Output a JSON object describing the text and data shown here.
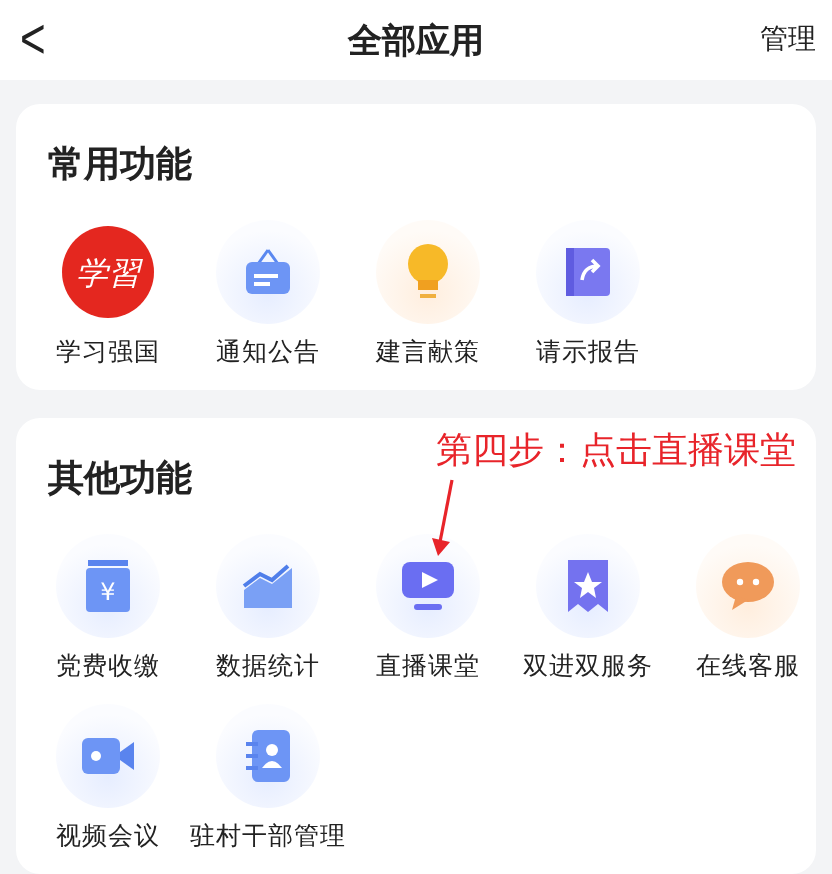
{
  "header": {
    "back": "<",
    "title": "全部应用",
    "action": "管理"
  },
  "sections": [
    {
      "title": "常用功能",
      "apps": [
        {
          "label": "学习强国",
          "kind": "logo",
          "logo_text": "学習"
        },
        {
          "label": "通知公告",
          "kind": "notice"
        },
        {
          "label": "建言献策",
          "kind": "bulb"
        },
        {
          "label": "请示报告",
          "kind": "report"
        }
      ]
    },
    {
      "title": "其他功能",
      "annotation": "第四步：点击直播课堂",
      "apps": [
        {
          "label": "党费收缴",
          "kind": "fee",
          "glyph": "¥"
        },
        {
          "label": "数据统计",
          "kind": "chart"
        },
        {
          "label": "直播课堂",
          "kind": "live"
        },
        {
          "label": "双进双服务",
          "kind": "ribbon"
        },
        {
          "label": "在线客服",
          "kind": "chat"
        },
        {
          "label": "视频会议",
          "kind": "video"
        },
        {
          "label": "驻村干部管理",
          "kind": "contact"
        }
      ]
    }
  ]
}
